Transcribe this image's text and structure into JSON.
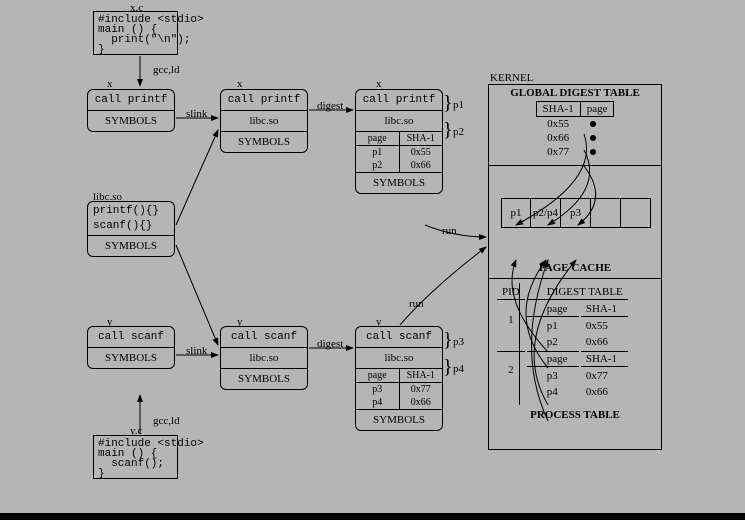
{
  "files": {
    "xc_name": "x.c",
    "xc_code": "#include <stdio>\nmain () {\n  print(\"\\n\");\n}",
    "yc_name": "y.c",
    "yc_code": "#include <stdio>\nmain () {\n  scanf();\n}"
  },
  "edges": {
    "gccld": "gcc,ld",
    "slink": "slink",
    "digest": "digest",
    "run": "run"
  },
  "boxes": {
    "x_label": "x",
    "y_label": "y",
    "call_printf": "call printf",
    "call_scanf": "call scanf",
    "symbols": "SYMBOLS",
    "libcso": "libc.so",
    "printf_decl": "printf(){}",
    "scanf_decl": "scanf(){}",
    "page_hdr": "page",
    "sha1_hdr": "SHA-1"
  },
  "digest_x": {
    "rows": [
      {
        "page": "p1",
        "sha": "0x55"
      },
      {
        "page": "p2",
        "sha": "0x66"
      }
    ]
  },
  "digest_y": {
    "rows": [
      {
        "page": "p3",
        "sha": "0x77"
      },
      {
        "page": "p4",
        "sha": "0x66"
      }
    ]
  },
  "p": {
    "p1": "p1",
    "p2": "p2",
    "p3": "p3",
    "p4": "p4",
    "p2p4": "p2/p4"
  },
  "kernel": {
    "title": "KERNEL",
    "gdt": "GLOBAL DIGEST TABLE",
    "gdt_rows": [
      {
        "sha": "0x55"
      },
      {
        "sha": "0x66"
      },
      {
        "sha": "0x77"
      }
    ],
    "pagecache": "PAGE CACHE",
    "process_table": "PROCESS TABLE",
    "pid": "PID",
    "digest_table": "DIGEST TABLE",
    "pid1": "1",
    "pid2": "2",
    "pt1": [
      {
        "page": "p1",
        "sha": "0x55"
      },
      {
        "page": "p2",
        "sha": "0x66"
      }
    ],
    "pt2": [
      {
        "page": "p3",
        "sha": "0x77"
      },
      {
        "page": "p4",
        "sha": "0x66"
      }
    ]
  },
  "chart_data": {
    "type": "diagram",
    "note": "Flow diagram showing compile → slink → digest → run into kernel page cache / digest tables"
  }
}
